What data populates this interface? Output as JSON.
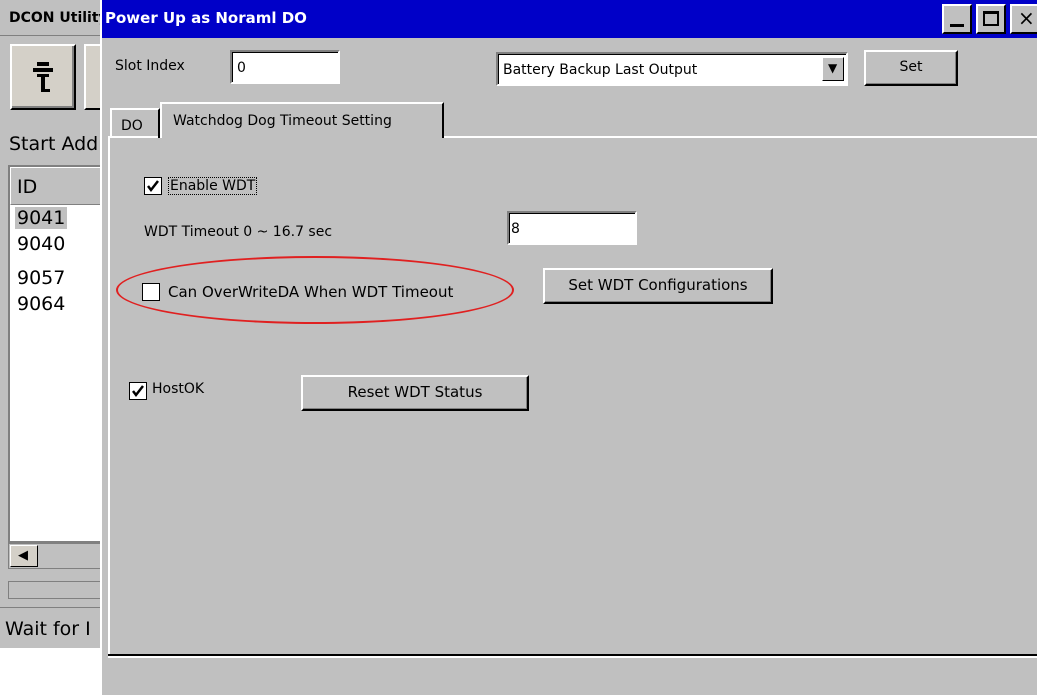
{
  "background_window": {
    "title": "DCON Utility",
    "start_label": "Start Address",
    "list_header": "ID",
    "list_items": [
      "9041",
      "9040",
      "9057",
      "9064"
    ],
    "status_text": "Wait for I"
  },
  "dialog": {
    "title": "Power Up as Noraml DO",
    "slot_label": "Slot Index",
    "slot_value": "0",
    "mode_value": "Battery Backup Last Output",
    "set_label": "Set",
    "tabs": [
      "DO",
      "Watchdog Dog Timeout Setting"
    ],
    "enable_wdt_label": "Enable WDT",
    "enable_wdt_checked": true,
    "wdt_timeout_label": "WDT Timeout  0 ~ 16.7 sec",
    "wdt_timeout_value": "8",
    "overwrite_label": "Can OverWriteDA When  WDT Timeout",
    "overwrite_checked": false,
    "set_wdt_label": "Set WDT Configurations",
    "hostok_label": "HostOK",
    "hostok_checked": true,
    "reset_label": "Reset WDT Status"
  },
  "colors": {
    "titlebar": "#0000c8",
    "window_bg": "#c0c0c0",
    "highlight": "#e02020"
  }
}
